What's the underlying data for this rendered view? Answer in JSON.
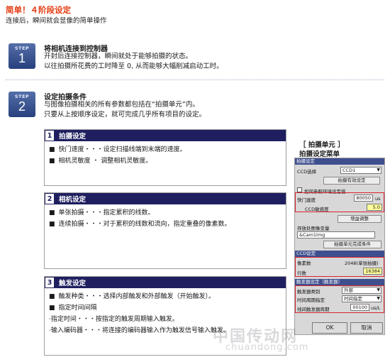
{
  "header": {
    "title": "简单！４阶段设定",
    "subtitle": "连接后，瞬间就会显像的简单操作"
  },
  "step1": {
    "label": "STEP",
    "number": "1",
    "title": "将相机连接到控制器",
    "line1": "开封后连接控制器，瞬间就处于能够拍摄的状态。",
    "line2": "以往拍摄所花费的工时降至 0, 从而能够大幅削减启动工时。"
  },
  "step2": {
    "label": "STEP",
    "number": "2",
    "title": "设定拍摄条件",
    "line1": "与图像拍摄相关的所有参数都包括在“拍摄单元”内。",
    "line2": "只要从上按顺序设定，就可完成几乎所有项目的设定。"
  },
  "sections": {
    "s1": {
      "num": "1",
      "title": "拍摄设定",
      "line1": "快门速度・・・设定扫描线端到末端的速度。",
      "line2": "相机灵敏度 ・ 调整相机灵敏度。"
    },
    "s2": {
      "num": "2",
      "title": "相机设定",
      "line1": "单张拍摄・・・指定累积的线数。",
      "line2": "连续拍摄・・・对于累积的线数和流向，指定重叠的像素数。"
    },
    "s3": {
      "num": "3",
      "title": "触发设定",
      "line1": "触发种类・・・选择内部触发和外部触发（开始触发）。",
      "line2": "指定时间间隔",
      "line3": "·指定时间・・・按指定的触发周期输入触发。",
      "line4": "·输入编码器・・・将连接的编码器输入作为触发信号输入触发。"
    }
  },
  "menu": {
    "caption1": "［ 拍摄单元 ］",
    "caption2": "拍摄设定菜单",
    "hd_capture": "拍摄设定",
    "ccd_select_label": "CCD选择",
    "ccd_select_value": "CCD1",
    "capture_valid_btn": "拍摄有效设定",
    "env_checkbox_label": "如何参照环境设定值",
    "shutter_label": "快门速度",
    "shutter_value": "80050",
    "shutter_unit": "us",
    "sensitivity_label": "CCD敏感度",
    "sensitivity_value": "5.0",
    "correction_btn": "增益调整",
    "save_var_label": "存放处图像变量",
    "save_var_value": "&Cam1Img",
    "done_cond_btn": "拍摄单元完成条件",
    "hd_ccd": "CCD设定",
    "pixels_label": "像素数",
    "pixels_value": "2048(单张拍摄)",
    "lines_label": "行数",
    "lines_value": "16384",
    "hd_trigger": "触发器设定（触发器）",
    "trig_type_label": "触发器类别",
    "trig_type_value": "外部",
    "interval_label": "时间周期指定",
    "interval_value": "时间指定",
    "period_label": "线间触发器周期",
    "period_value": "00100",
    "period_unit": "us/L",
    "ok": "OK",
    "cancel": "取消"
  },
  "watermark": {
    "cn": "中国传动网",
    "en": "chuandong.com"
  }
}
